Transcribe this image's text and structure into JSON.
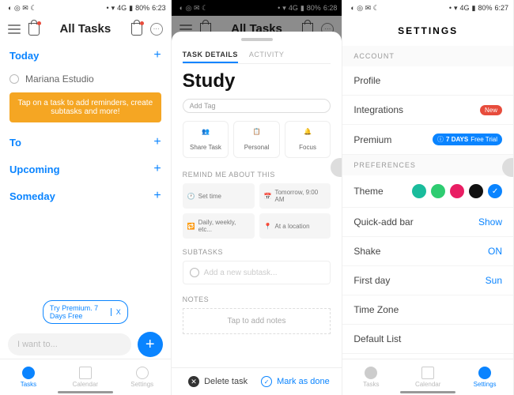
{
  "status": {
    "signal": "4G",
    "battery": "80%",
    "t1": "6:23",
    "t2": "6:28",
    "t3": "6:27"
  },
  "app": {
    "title": "All Tasks"
  },
  "p1": {
    "today": "Today",
    "task": "Mariana Estudio",
    "tooltip": "Tap on a task to add reminders, create subtasks and more!",
    "tom": "To",
    "upcoming": "Upcoming",
    "someday": "Someday",
    "premium": "Try Premium. 7 Days Free",
    "x": "X",
    "input": "I want to...",
    "nav": {
      "tasks": "Tasks",
      "cal": "Calendar",
      "set": "Settings"
    }
  },
  "p2": {
    "tabs": {
      "details": "TASK DETAILS",
      "activity": "ACTIVITY"
    },
    "title": "Study",
    "addtag": "Add Tag",
    "actions": {
      "share": "Share Task",
      "personal": "Personal",
      "focus": "Focus"
    },
    "remind": "REMIND ME ABOUT THIS",
    "chips": {
      "time": "Set time",
      "tmrw": "Tomorrow, 9:00 AM",
      "repeat": "Daily, weekly, etc...",
      "loc": "At a location"
    },
    "subtasks": "SUBTASKS",
    "addsub": "Add a new subtask...",
    "notes": "NOTES",
    "tapnotes": "Tap to add notes",
    "delete": "Delete task",
    "done": "Mark as done"
  },
  "p3": {
    "title": "SETTINGS",
    "account": "ACCOUNT",
    "profile": "Profile",
    "integrations": "Integrations",
    "new": "New",
    "premium": "Premium",
    "trial_days": "7 DAYS",
    "trial_text": "Free Trial",
    "prefs": "PREFERENCES",
    "theme": "Theme",
    "colors": [
      "#1abc9c",
      "#2ecc71",
      "#e91e63",
      "#111111",
      "#0a84ff"
    ],
    "quickadd": "Quick-add bar",
    "show": "Show",
    "shake": "Shake",
    "on": "ON",
    "firstday": "First day",
    "sun": "Sun",
    "tz": "Time Zone",
    "deflist": "Default List"
  }
}
